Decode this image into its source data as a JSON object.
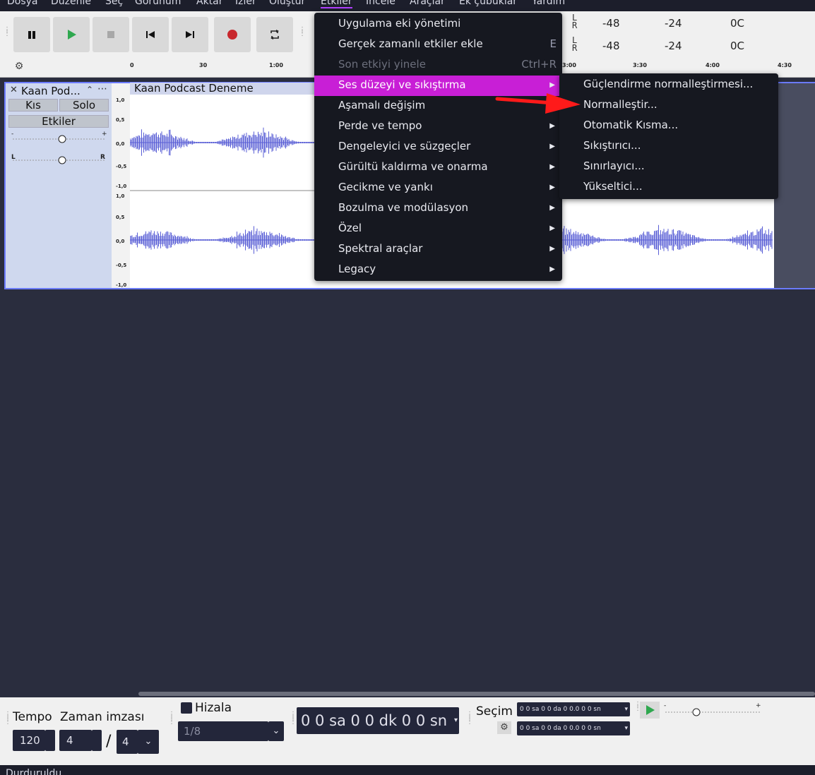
{
  "menubar": {
    "items": [
      "Dosya",
      "Düzenle",
      "Seç",
      "Görünüm",
      "Aktar",
      "İzler",
      "Oluştur",
      "Etkiler",
      "İncele",
      "Araçlar",
      "Ek çubuklar",
      "Yardım"
    ],
    "active": "Etkiler"
  },
  "meters": {
    "row1": {
      "a": "-48",
      "b": "-24",
      "c": "0C"
    },
    "row2": {
      "a": "-48",
      "b": "-24",
      "c": "0C"
    }
  },
  "ruler": {
    "ticks": [
      "0",
      "30",
      "1:00",
      "3:00",
      "3:30",
      "4:00",
      "4:30"
    ]
  },
  "track": {
    "name": "Kaan Pod...",
    "mute_label": "Kıs",
    "solo_label": "Solo",
    "effects_label": "Etkiler",
    "clip_title": "Kaan Podcast Deneme",
    "scale_labels": [
      "1,0",
      "0,5",
      "0,0",
      "-0,5",
      "-1,0",
      "1,0",
      "0,5",
      "0,0",
      "-0,5",
      "-1,0"
    ]
  },
  "effects_menu": {
    "items": [
      {
        "label": "Uygulama eki yönetimi",
        "shortcut": "",
        "submenu": false,
        "disabled": false
      },
      {
        "label": "Gerçek zamanlı etkiler ekle",
        "shortcut": "E",
        "submenu": false,
        "disabled": false
      },
      {
        "label": "Son etkiyi yinele",
        "shortcut": "Ctrl+R",
        "submenu": false,
        "disabled": true
      },
      {
        "label": "Ses düzeyi ve sıkıştırma",
        "shortcut": "",
        "submenu": true,
        "disabled": false,
        "highlighted": true
      },
      {
        "label": "Aşamalı değişim",
        "shortcut": "",
        "submenu": false,
        "disabled": false
      },
      {
        "label": "Perde ve tempo",
        "shortcut": "",
        "submenu": true,
        "disabled": false
      },
      {
        "label": "Dengeleyici ve süzgeçler",
        "shortcut": "",
        "submenu": true,
        "disabled": false
      },
      {
        "label": "Gürültü kaldırma ve onarma",
        "shortcut": "",
        "submenu": true,
        "disabled": false
      },
      {
        "label": "Gecikme ve yankı",
        "shortcut": "",
        "submenu": true,
        "disabled": false
      },
      {
        "label": "Bozulma ve modülasyon",
        "shortcut": "",
        "submenu": true,
        "disabled": false
      },
      {
        "label": "Özel",
        "shortcut": "",
        "submenu": true,
        "disabled": false
      },
      {
        "label": "Spektral araçlar",
        "shortcut": "",
        "submenu": true,
        "disabled": false
      },
      {
        "label": "Legacy",
        "shortcut": "",
        "submenu": true,
        "disabled": false
      }
    ]
  },
  "volume_submenu": {
    "items": [
      "Güçlendirme normalleştirmesi...",
      "Normalleştir...",
      "Otomatik Kısma...",
      "Sıkıştırıcı...",
      "Sınırlayıcı...",
      "Yükseltici..."
    ]
  },
  "bottom": {
    "tempo_label": "Tempo",
    "time_sig_label": "Zaman imzası",
    "tempo_value": "120",
    "time_sig_num": "4",
    "time_sig_den": "4",
    "snap_label": "Hizala",
    "snap_value": "1/8",
    "time_display": "0 0 sa 0 0 dk 0 0 sn",
    "selection_label": "Seçim",
    "sel_start": "0 0 sa 0 0 da 0 0.0 0 0 sn",
    "sel_end": "0 0 sa 0 0 da 0 0.0 0 0 sn"
  },
  "status": {
    "text": "Durduruldu."
  },
  "colors": {
    "accent": "#c81fd6",
    "selection_border": "#6b7bff",
    "waveform": "#5a5fd6",
    "arrow": "#ff1a1a"
  }
}
